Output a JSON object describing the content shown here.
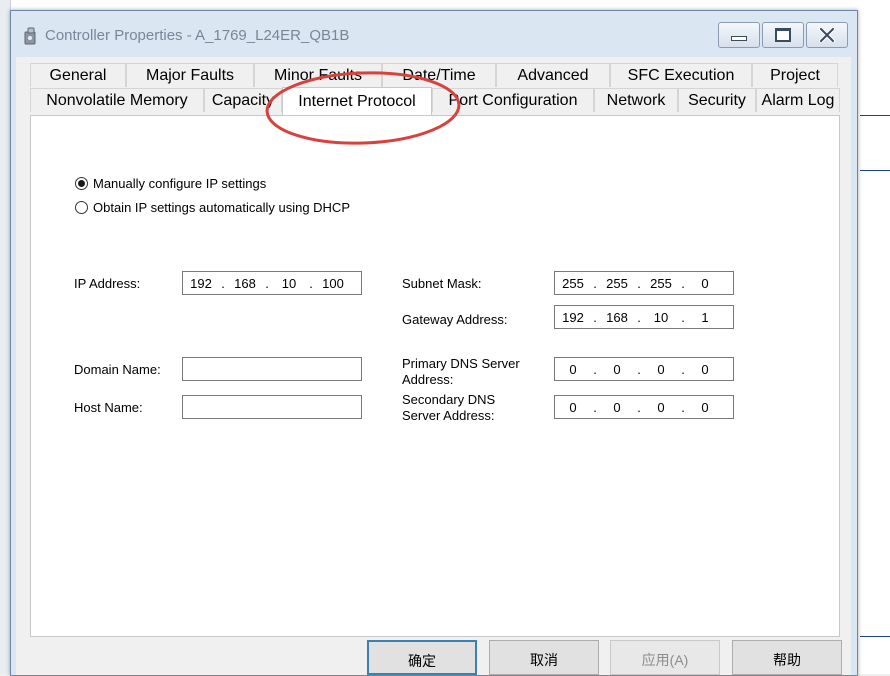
{
  "window": {
    "title": "Controller Properties - A_1769_L24ER_QB1B",
    "icon": "controller-icon",
    "controls": [
      "minimize-icon",
      "maximize-icon",
      "close-icon"
    ]
  },
  "tabs_row1": [
    "General",
    "Major Faults",
    "Minor Faults",
    "Date/Time",
    "Advanced",
    "SFC Execution",
    "Project"
  ],
  "tabs_row2": [
    "Nonvolatile Memory",
    "Capacity",
    "Internet Protocol",
    "Port Configuration",
    "Network",
    "Security",
    "Alarm Log"
  ],
  "active_tab": "Internet Protocol",
  "ip_mode": {
    "manual_label": "Manually configure IP settings",
    "dhcp_label": "Obtain IP settings automatically using DHCP",
    "selected": "manual"
  },
  "fields": {
    "ip_address": {
      "label": "IP Address:",
      "octets": [
        "192",
        "168",
        "10",
        "100"
      ]
    },
    "subnet_mask": {
      "label": "Subnet Mask:",
      "octets": [
        "255",
        "255",
        "255",
        "0"
      ]
    },
    "gateway": {
      "label": "Gateway Address:",
      "octets": [
        "192",
        "168",
        "10",
        "1"
      ]
    },
    "domain_name": {
      "label": "Domain Name:",
      "value": ""
    },
    "host_name": {
      "label": "Host Name:",
      "value": ""
    },
    "primary_dns": {
      "label_line1": "Primary DNS Server",
      "label_line2": "Address:",
      "octets": [
        "0",
        "0",
        "0",
        "0"
      ]
    },
    "secondary_dns": {
      "label_line1": "Secondary DNS",
      "label_line2": "Server Address:",
      "octets": [
        "0",
        "0",
        "0",
        "0"
      ]
    }
  },
  "buttons": {
    "ok": "确定",
    "cancel": "取消",
    "apply": "应用(A)",
    "help": "帮助"
  },
  "colors": {
    "annotation": "#d9413d",
    "default_button_border": "#3c7fb1"
  }
}
